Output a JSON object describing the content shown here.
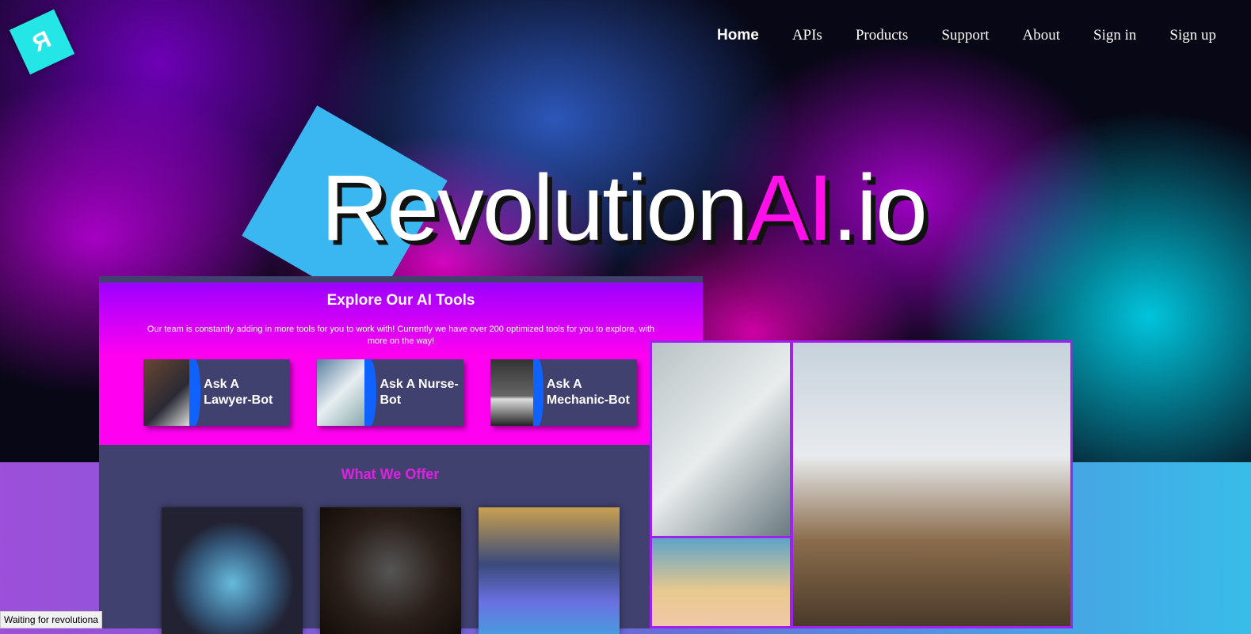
{
  "logo": {
    "letter": "Я"
  },
  "nav": [
    "Home",
    "APIs",
    "Products",
    "Support",
    "About",
    "Sign in",
    "Sign up"
  ],
  "brand": {
    "main": "Revolution",
    "ai": "AI",
    "suffix": ".io"
  },
  "tools": {
    "title": "Explore Our AI Tools",
    "description": "Our team is constantly adding in more tools for you to work with! Currently we have over 200 optimized tools for you to explore, with more on the way!",
    "cards": [
      "Ask A Lawyer-Bot",
      "Ask A Nurse-Bot",
      "Ask A Mechanic-Bot"
    ]
  },
  "offer": {
    "title": "What We Offer"
  },
  "status": "Waiting for revolutiona"
}
